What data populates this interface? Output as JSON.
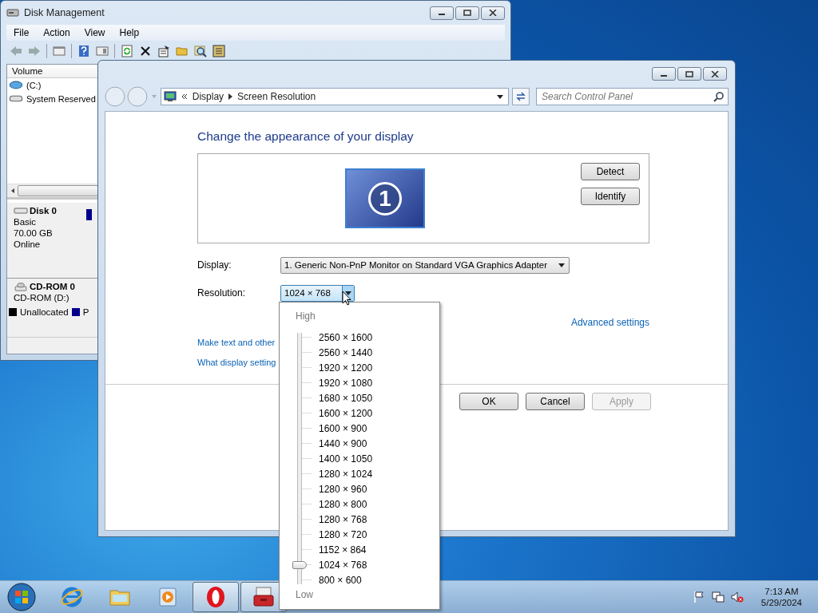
{
  "disk_management": {
    "title": "Disk Management",
    "menu": [
      "File",
      "Action",
      "View",
      "Help"
    ],
    "volume_column": "Volume",
    "volumes": [
      {
        "name": "(C:)",
        "kind": "volume"
      },
      {
        "name": "System Reserved",
        "kind": "system"
      }
    ],
    "disks": [
      {
        "name": "Disk 0",
        "kind": "disk",
        "lines": [
          "Basic",
          "70.00 GB",
          "Online"
        ]
      },
      {
        "name": "CD-ROM 0",
        "kind": "cdrom",
        "lines": [
          "CD-ROM (D:)"
        ]
      }
    ],
    "legend": [
      {
        "label": "Unallocated",
        "color": "#000000"
      },
      {
        "label": "P",
        "color": "#00008b"
      }
    ]
  },
  "control_panel": {
    "breadcrumb": [
      "Display",
      "Screen Resolution"
    ],
    "search": {
      "placeholder": "Search Control Panel"
    },
    "heading": "Change the appearance of your display",
    "monitor_number": "1",
    "side_buttons": [
      "Detect",
      "Identify"
    ],
    "display": {
      "label": "Display:",
      "value": "1. Generic Non-PnP Monitor on Standard VGA Graphics Adapter"
    },
    "resolution": {
      "label": "Resolution:",
      "value": "1024 × 768"
    },
    "advanced_link": "Advanced settings",
    "links": [
      "Make text and other",
      "What display setting"
    ],
    "buttons": [
      {
        "label": "OK",
        "disabled": false
      },
      {
        "label": "Cancel",
        "disabled": false
      },
      {
        "label": "Apply",
        "disabled": true
      }
    ]
  },
  "resolution_menu": {
    "high": "High",
    "low": "Low",
    "level": 0.0625,
    "options": [
      "2560 × 1600",
      "2560 × 1440",
      "1920 × 1200",
      "1920 × 1080",
      "1680 × 1050",
      "1600 × 1200",
      "1600 × 900",
      "1440 × 900",
      "1400 × 1050",
      "1280 × 1024",
      "1280 × 960",
      "1280 × 800",
      "1280 × 768",
      "1280 × 720",
      "1152 × 864",
      "1024 × 768",
      "800 × 600"
    ]
  },
  "taskbar": {
    "apps": [
      {
        "kind": "browser",
        "active": false
      },
      {
        "kind": "folder",
        "active": false
      },
      {
        "kind": "media",
        "active": false
      },
      {
        "kind": "opera",
        "active": true
      },
      {
        "kind": "toolbox",
        "active": true
      }
    ],
    "time": "7:13 AM",
    "date": "5/29/2024"
  }
}
